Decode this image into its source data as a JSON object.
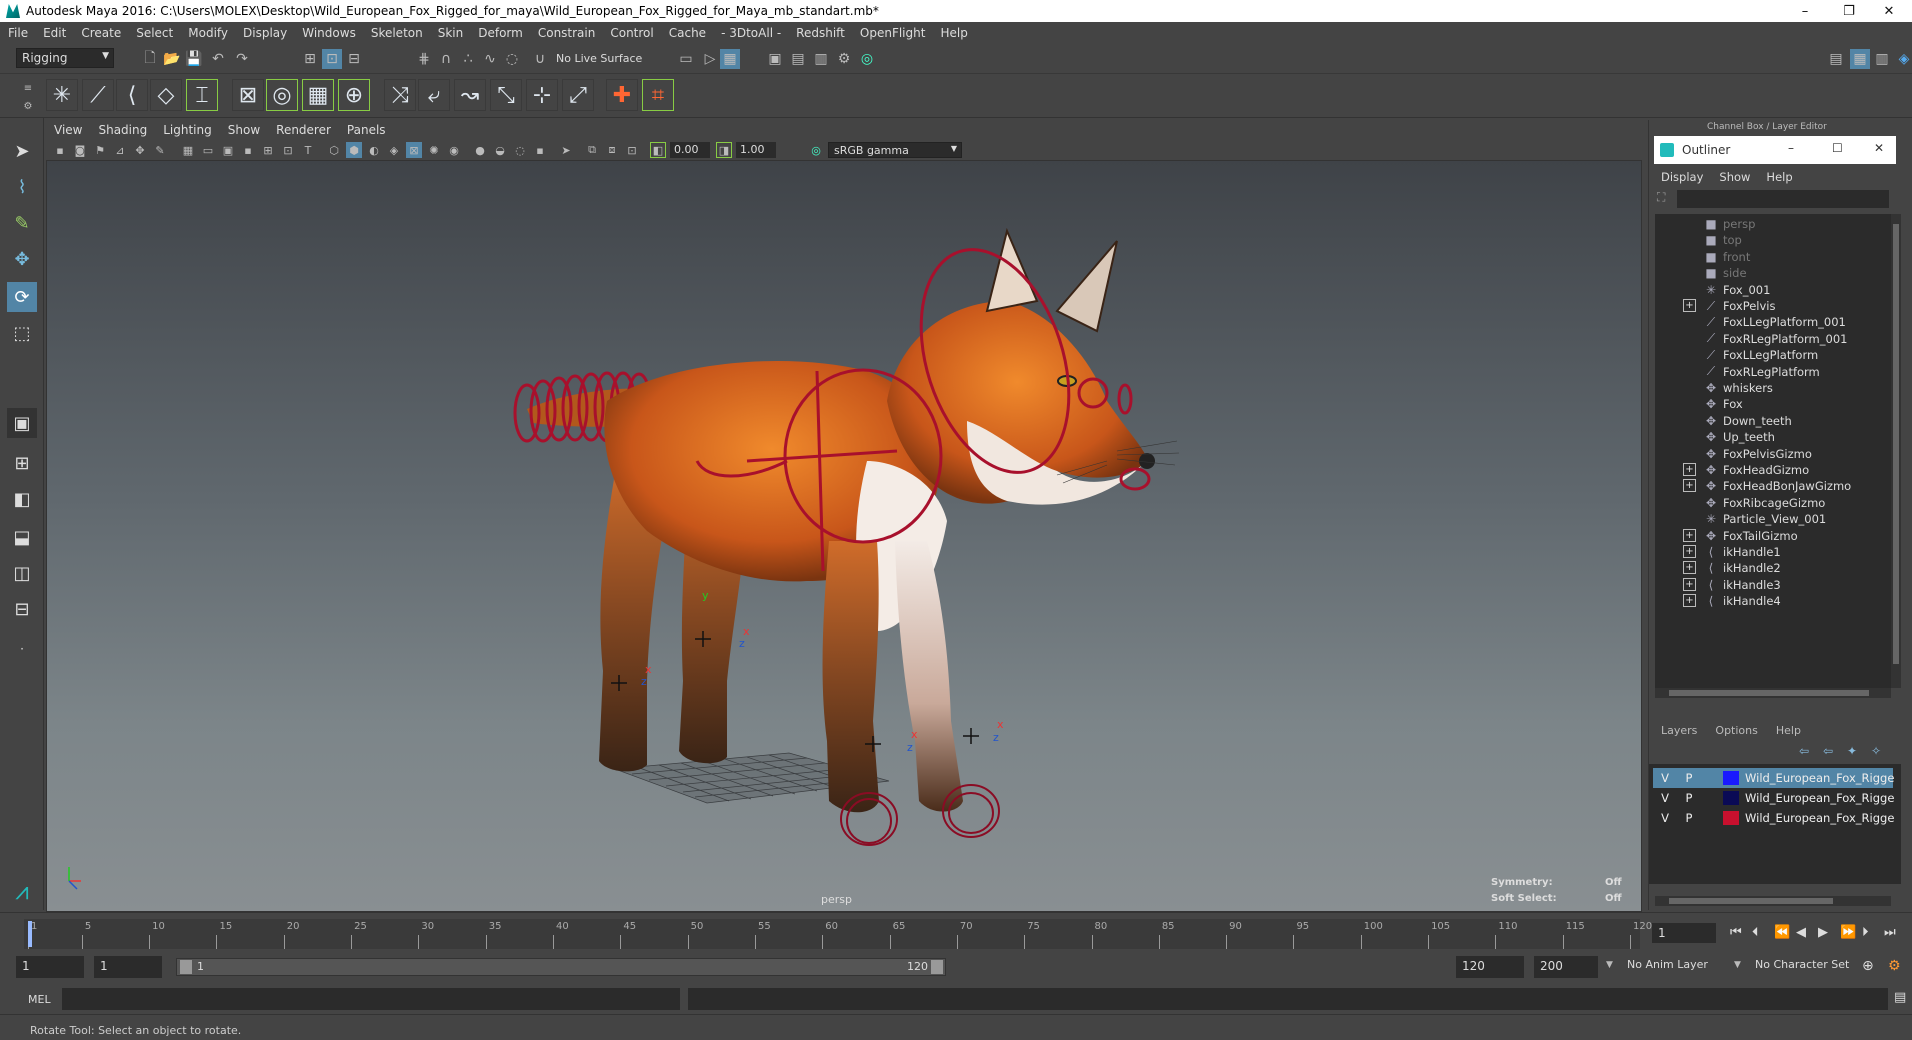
{
  "window": {
    "title": "Autodesk Maya 2016: C:\\Users\\MOLEX\\Desktop\\Wild_European_Fox_Rigged_for_maya\\Wild_European_Fox_Rigged_for_Maya_mb_standart.mb*",
    "minimize": "–",
    "restore": "❐",
    "close": "✕"
  },
  "menubar": [
    "File",
    "Edit",
    "Create",
    "Select",
    "Modify",
    "Display",
    "Windows",
    "Skeleton",
    "Skin",
    "Deform",
    "Constrain",
    "Control",
    "Cache",
    "- 3DtoAll -",
    "Redshift",
    "OpenFlight",
    "Help"
  ],
  "statusline": {
    "mode": "Rigging",
    "live_surface": "No Live Surface"
  },
  "viewport": {
    "menu": [
      "View",
      "Shading",
      "Lighting",
      "Show",
      "Renderer",
      "Panels"
    ],
    "exposure": "0.00",
    "gamma": "1.00",
    "color_space": "sRGB gamma",
    "camera": "persp",
    "symmetry_label": "Symmetry:",
    "symmetry_value": "Off",
    "soft_select_label": "Soft Select:",
    "soft_select_value": "Off"
  },
  "right_panel": {
    "channel_box_title": "Channel Box / Layer Editor",
    "outliner": {
      "title": "Outliner",
      "menu": [
        "Display",
        "Show",
        "Help"
      ],
      "items": [
        {
          "label": "persp",
          "icon": "camera-icon",
          "expand": false,
          "dim": true
        },
        {
          "label": "top",
          "icon": "camera-icon",
          "expand": false,
          "dim": true
        },
        {
          "label": "front",
          "icon": "camera-icon",
          "expand": false,
          "dim": true
        },
        {
          "label": "side",
          "icon": "camera-icon",
          "expand": false,
          "dim": true
        },
        {
          "label": "Fox_001",
          "icon": "locator-icon",
          "expand": false,
          "dim": false
        },
        {
          "label": "FoxPelvis",
          "icon": "joint-icon",
          "expand": true,
          "dim": false
        },
        {
          "label": "FoxLLegPlatform_001",
          "icon": "joint-icon",
          "expand": false,
          "dim": false
        },
        {
          "label": "FoxRLegPlatform_001",
          "icon": "joint-icon",
          "expand": false,
          "dim": false
        },
        {
          "label": "FoxLLegPlatform",
          "icon": "joint-icon",
          "expand": false,
          "dim": false
        },
        {
          "label": "FoxRLegPlatform",
          "icon": "joint-icon",
          "expand": false,
          "dim": false
        },
        {
          "label": "whiskers",
          "icon": "mesh-icon",
          "expand": false,
          "dim": false
        },
        {
          "label": "Fox",
          "icon": "mesh-icon",
          "expand": false,
          "dim": false
        },
        {
          "label": "Down_teeth",
          "icon": "mesh-icon",
          "expand": false,
          "dim": false
        },
        {
          "label": "Up_teeth",
          "icon": "mesh-icon",
          "expand": false,
          "dim": false
        },
        {
          "label": "FoxPelvisGizmo",
          "icon": "mesh-icon",
          "expand": false,
          "dim": false
        },
        {
          "label": "FoxHeadGizmo",
          "icon": "mesh-icon",
          "expand": true,
          "dim": false
        },
        {
          "label": "FoxHeadBonJawGizmo",
          "icon": "mesh-icon",
          "expand": true,
          "dim": false
        },
        {
          "label": "FoxRibcageGizmo",
          "icon": "mesh-icon",
          "expand": false,
          "dim": false
        },
        {
          "label": "Particle_View_001",
          "icon": "locator-icon",
          "expand": false,
          "dim": false
        },
        {
          "label": "FoxTailGizmo",
          "icon": "mesh-icon",
          "expand": true,
          "dim": false
        },
        {
          "label": "ikHandle1",
          "icon": "ik-icon",
          "expand": true,
          "dim": false
        },
        {
          "label": "ikHandle2",
          "icon": "ik-icon",
          "expand": true,
          "dim": false
        },
        {
          "label": "ikHandle3",
          "icon": "ik-icon",
          "expand": true,
          "dim": false
        },
        {
          "label": "ikHandle4",
          "icon": "ik-icon",
          "expand": true,
          "dim": false
        }
      ]
    },
    "layers_menu": [
      "Layers",
      "Options",
      "Help"
    ],
    "layers": [
      {
        "v": "V",
        "p": "P",
        "color": "#1a1aff",
        "name": "Wild_European_Fox_Rigged",
        "selected": true
      },
      {
        "v": "V",
        "p": "P",
        "color": "#0a0a55",
        "name": "Wild_European_Fox_Rigged_",
        "selected": false
      },
      {
        "v": "V",
        "p": "P",
        "color": "#c8102e",
        "name": "Wild_European_Fox_Rigged_",
        "selected": false
      }
    ]
  },
  "timeline": {
    "ticks": [
      "1",
      "5",
      "10",
      "15",
      "20",
      "25",
      "30",
      "35",
      "40",
      "45",
      "50",
      "55",
      "60",
      "65",
      "70",
      "75",
      "80",
      "85",
      "90",
      "95",
      "100",
      "105",
      "110",
      "115",
      "120"
    ],
    "current_frame": "1"
  },
  "range": {
    "start": "1",
    "anim_start": "1",
    "slider_start": "1",
    "slider_end": "120",
    "anim_end": "120",
    "end": "200",
    "anim_layer": "No Anim Layer",
    "char_set": "No Character Set"
  },
  "cmdline": {
    "lang": "MEL"
  },
  "helpline": "Rotate Tool: Select an object to rotate.",
  "colors": {
    "accent": "#5285a6",
    "control_red": "#b0102c",
    "fox_orange": "#d8641c"
  }
}
